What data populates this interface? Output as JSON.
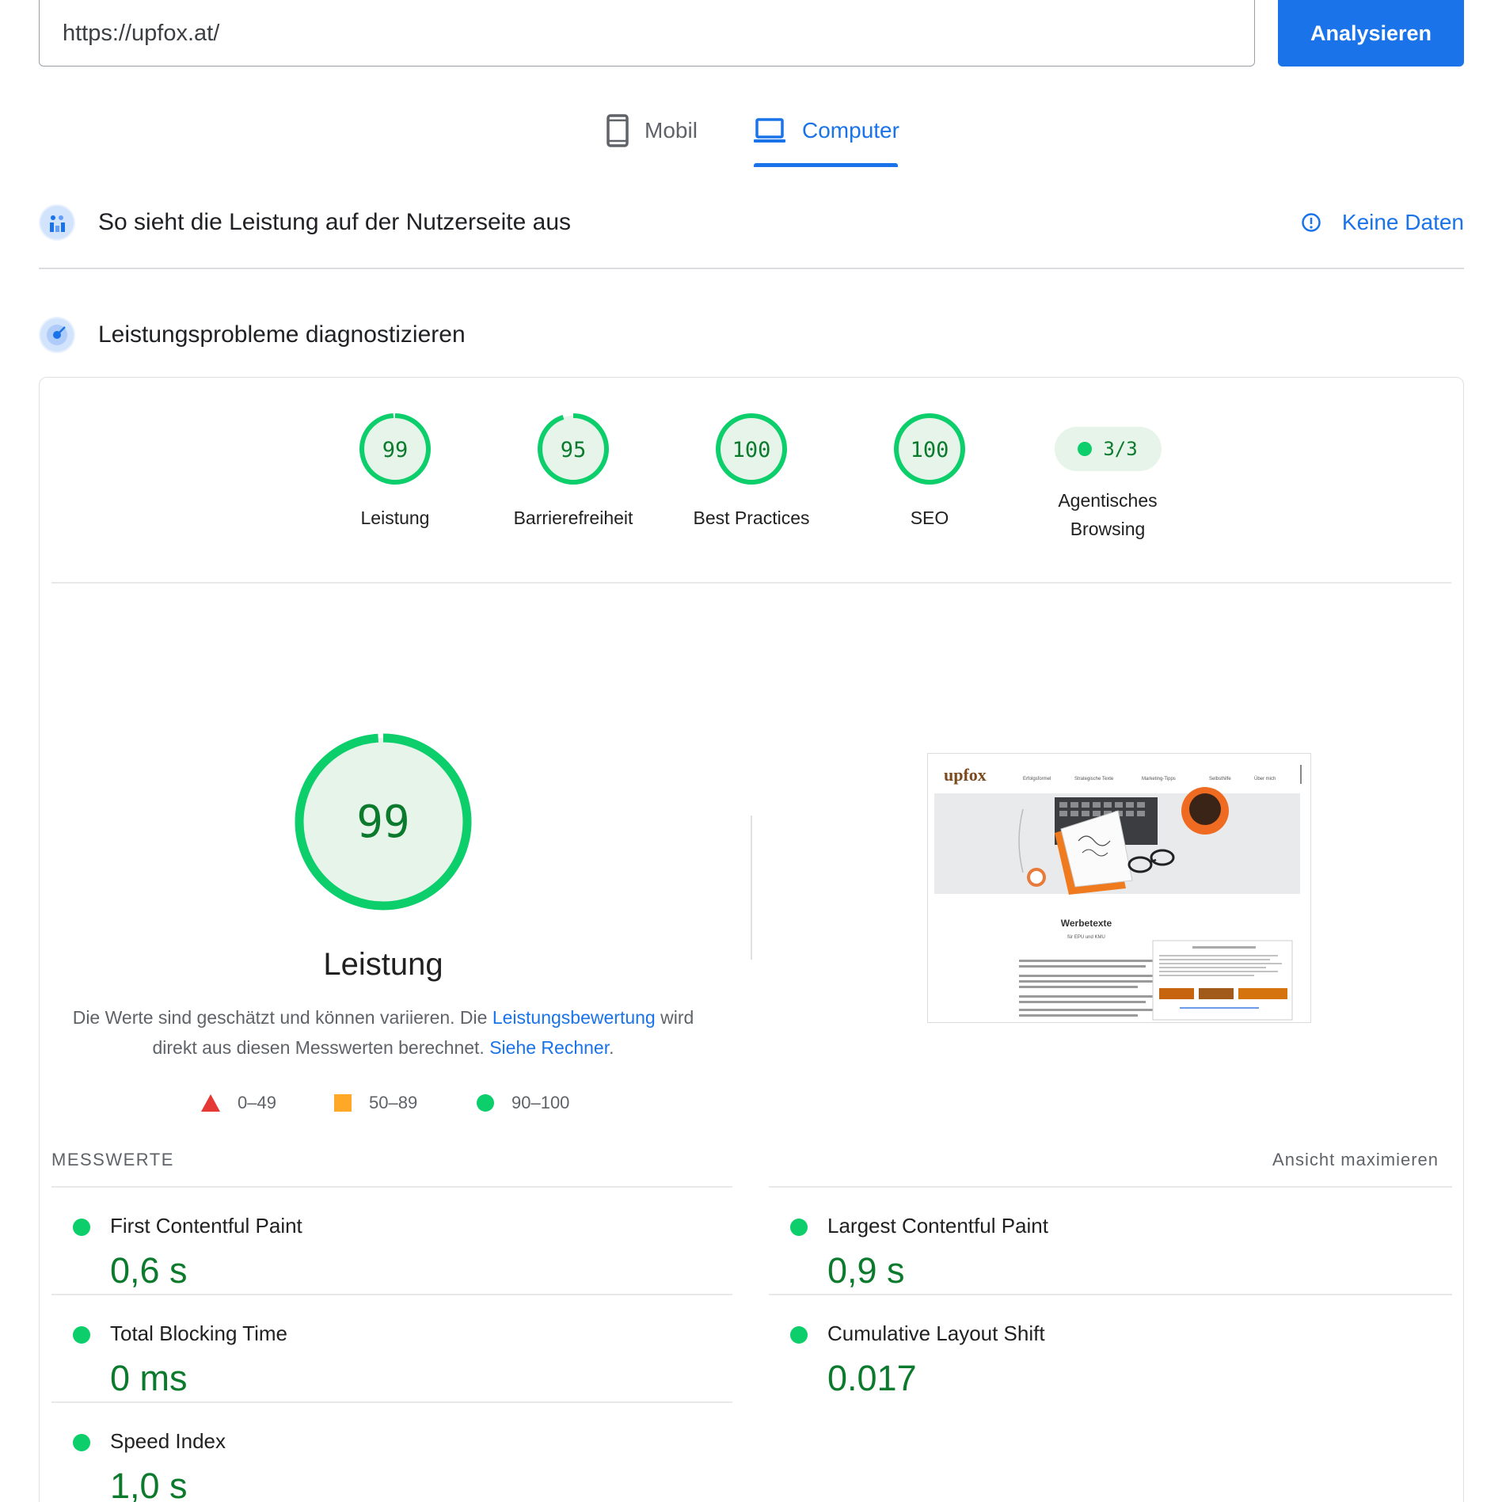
{
  "url_input": {
    "value": "https://upfox.at/"
  },
  "analyze_button": {
    "label": "Analysieren"
  },
  "tabs": [
    {
      "label": "Mobil",
      "icon": "phone-icon",
      "active": false
    },
    {
      "label": "Computer",
      "icon": "laptop-icon",
      "active": true
    }
  ],
  "field_section": {
    "title": "So sieht die Leistung auf der Nutzerseite aus",
    "status": "Keine Daten",
    "icon": "info-icon"
  },
  "lab_section": {
    "title": "Leistungsprobleme diagnostizieren"
  },
  "gauges": [
    {
      "label": "Leistung",
      "score": "99",
      "fraction": 0.99
    },
    {
      "label": "Barrierefreiheit",
      "score": "95",
      "fraction": 0.95
    },
    {
      "label": "Best Practices",
      "score": "100",
      "fraction": 1.0
    },
    {
      "label": "SEO",
      "score": "100",
      "fraction": 1.0
    }
  ],
  "agentic": {
    "value": "3/3",
    "label_line1": "Agentisches",
    "label_line2": "Browsing"
  },
  "performance": {
    "score": "99",
    "fraction": 0.99,
    "title": "Leistung",
    "desc_part1": "Die Werte sind geschätzt und können variieren. Die ",
    "desc_link1": "Leistungsbewertung",
    "desc_part2": " wird direkt aus diesen Messwerten berechnet. ",
    "desc_link2": "Siehe Rechner",
    "desc_end": "."
  },
  "legend": [
    {
      "range": "0–49",
      "color": "#e53935"
    },
    {
      "range": "50–89",
      "color": "#ffa726"
    },
    {
      "range": "90–100",
      "color": "#0cce6b"
    }
  ],
  "thumbnail": {
    "brand": "upfox",
    "nav": [
      "Erfolgsformel",
      "Strategische Texte",
      "Marketing-Tipps",
      "Selbsthilfe",
      "Über mich"
    ],
    "headline": "Werbetexte",
    "subheadline": "für EPU und KMU"
  },
  "metrics": {
    "heading": "MESSWERTE",
    "expand_label": "Ansicht maximieren",
    "items": [
      {
        "name": "First Contentful Paint",
        "value": "0,6 s"
      },
      {
        "name": "Largest Contentful Paint",
        "value": "0,9 s"
      },
      {
        "name": "Total Blocking Time",
        "value": "0 ms"
      },
      {
        "name": "Cumulative Layout Shift",
        "value": "0.017"
      },
      {
        "name": "Speed Index",
        "value": "1,0 s"
      }
    ]
  },
  "colors": {
    "accent": "#1a73e8",
    "pass": "#0cce6b",
    "pass_text": "#0c7a2d",
    "pass_fill": "#e6f4ea"
  }
}
